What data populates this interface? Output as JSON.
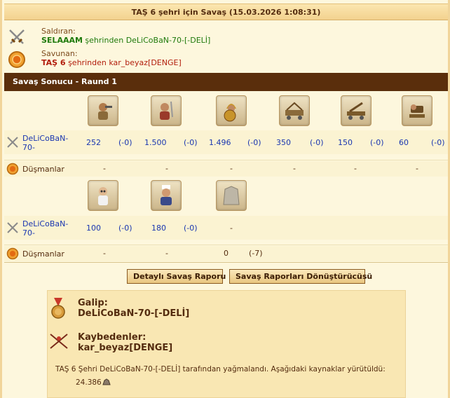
{
  "title": "TAŞ 6 şehri için Savaş (15.03.2026 1:08:31)",
  "attacker": {
    "role": "Saldıran:",
    "city": "SELAAAM",
    "text_mid": " şehrinden ",
    "player": "DeLiCoBaN-70-[-DELİ]"
  },
  "defender": {
    "role": "Savunan:",
    "city": "TAŞ 6",
    "text_mid": " şehrinden ",
    "player": "kar_beyaz[DENGE]"
  },
  "section_title": "Savaş Sonucu - Raund 1",
  "row1": {
    "units": [
      "slinger-unit-icon",
      "swordsman-unit-icon",
      "hoplite-unit-icon",
      "ram-unit-icon",
      "catapult-unit-icon",
      "mortar-unit-icon"
    ],
    "attacker_name": "DeLiCoBaN-70-",
    "attacker_counts": [
      "252",
      "1.500",
      "1.496",
      "350",
      "150",
      "60"
    ],
    "attacker_losses": [
      "(-0)",
      "(-0)",
      "(-0)",
      "(-0)",
      "(-0)",
      "(-0)"
    ],
    "enemy_label": "Düşmanlar",
    "enemy_values": [
      "-",
      "-",
      "-",
      "-",
      "-",
      "-"
    ]
  },
  "row2": {
    "units": [
      "doctor-unit-icon",
      "cook-unit-icon",
      "wall-icon"
    ],
    "attacker_name": "DeLiCoBaN-70-",
    "attacker_counts": [
      "100",
      "180",
      "-"
    ],
    "attacker_losses": [
      "(-0)",
      "(-0)",
      ""
    ],
    "enemy_label": "Düşmanlar",
    "enemy_values": [
      "-",
      "-",
      "0"
    ],
    "enemy_wall_loss": "(-7)"
  },
  "buttons": {
    "detailed": "Detaylı Savaş Raporu",
    "converter": "Savaş Raporları Dönüştürücüsü"
  },
  "result": {
    "winner_label": "Galip:",
    "winner": "DeLiCoBaN-70-[-DELİ]",
    "loser_label": "Kaybedenler:",
    "loser": "kar_beyaz[DENGE]",
    "plunder_text": "TAŞ 6 Şehri DeLiCoBaN-70-[-DELİ] tarafından yağmalandı. Aşağıdaki kaynaklar yürütüldü:",
    "amount": "24.386",
    "resource_icon": "marble-icon"
  },
  "colors": {
    "header_bg": "#5a2e0c",
    "background": "#fdf7dd",
    "link": "#1a36b0",
    "green": "#1f7a0c",
    "red": "#b21d0c"
  }
}
